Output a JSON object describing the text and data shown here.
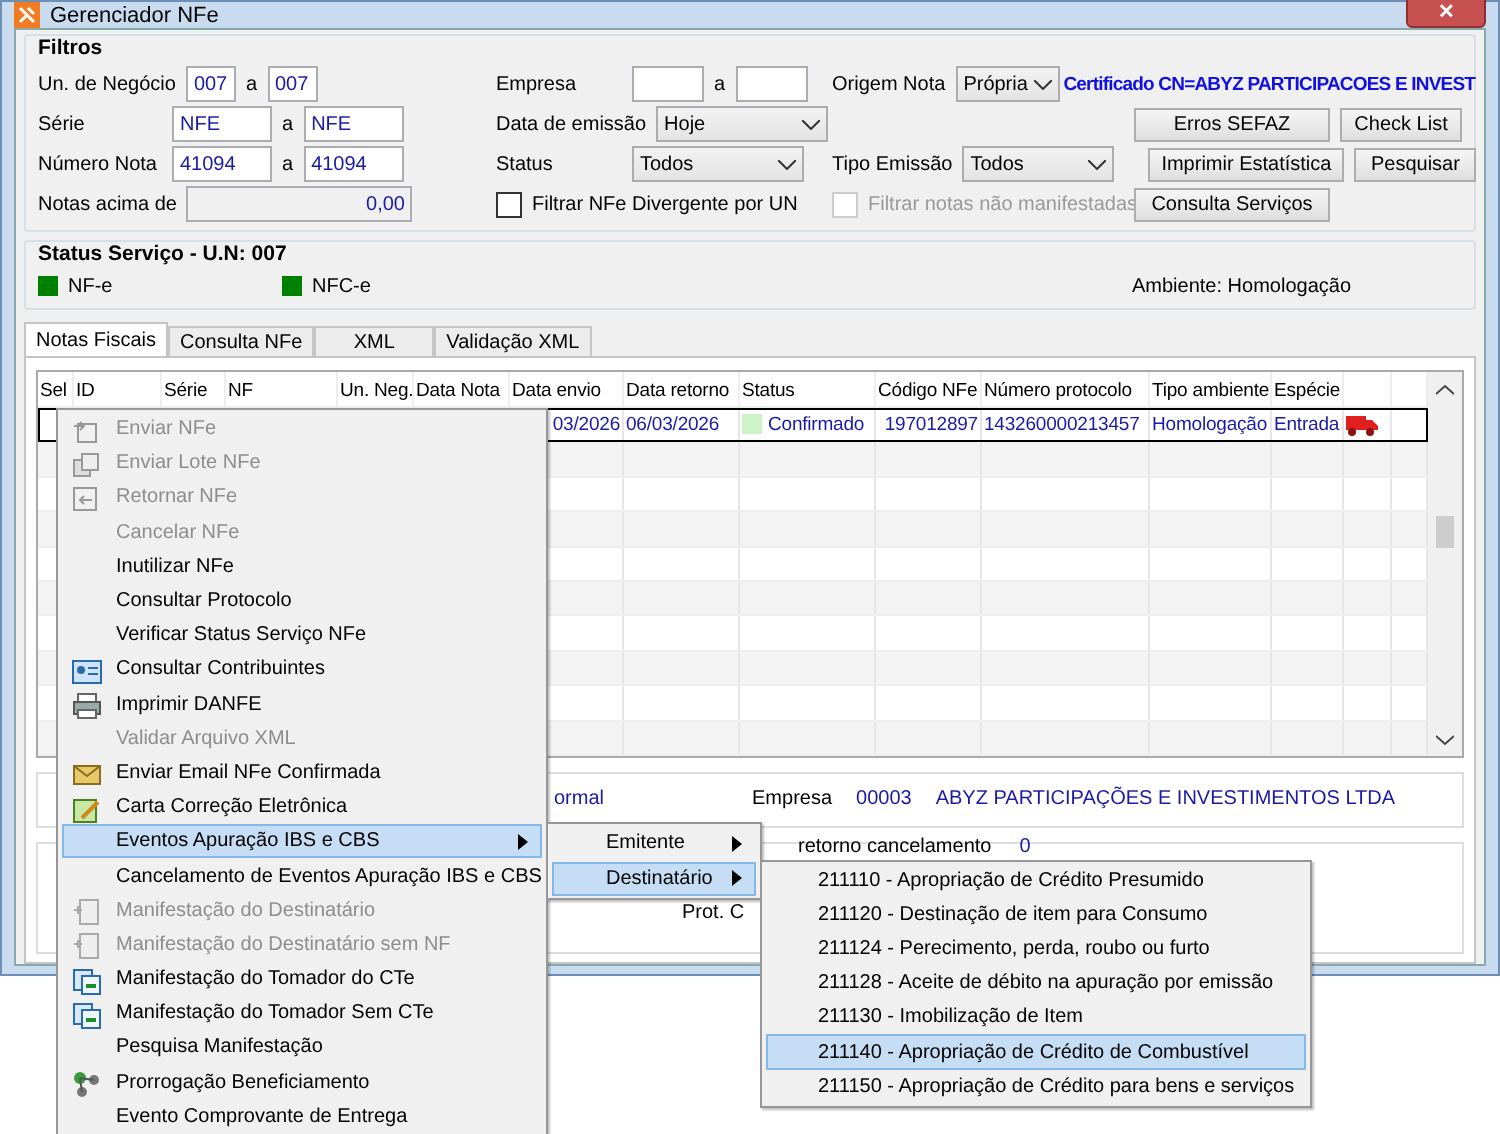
{
  "window": {
    "title": "Gerenciador NFe",
    "close": "✕"
  },
  "filters": {
    "title": "Filtros",
    "un_negocio": {
      "label": "Un. de Negócio",
      "from": "007",
      "sep": "a",
      "to": "007"
    },
    "serie": {
      "label": "Série",
      "from": "NFE",
      "sep": "a",
      "to": "NFE"
    },
    "numero": {
      "label": "Número Nota",
      "from": "41094",
      "sep": "a",
      "to": "41094"
    },
    "notas_acima": {
      "label": "Notas acima de",
      "value": "0,00",
      "disabled": true
    },
    "empresa": {
      "label": "Empresa",
      "sep": "a"
    },
    "data_emissao": {
      "label": "Data de emissão",
      "value": "Hoje"
    },
    "status": {
      "label": "Status",
      "value": "Todos"
    },
    "filtrar_divergente": {
      "label": "Filtrar NFe Divergente por UN",
      "checked": false,
      "disabled": false
    },
    "origem": {
      "label": "Origem Nota",
      "value": "Própria"
    },
    "certificado": "Certificado CN=ABYZ PARTICIPACOES E INVEST",
    "tipo_emissao": {
      "label": "Tipo Emissão",
      "value": "Todos"
    },
    "filtrar_manifestadas": {
      "label": "Filtrar notas não manifestadas",
      "checked": false,
      "disabled": true
    },
    "buttons": [
      [
        "Erros SEFAZ",
        "Check List"
      ],
      [
        "Imprimir Estatística",
        "Pesquisar"
      ],
      [
        "Consulta Serviços"
      ]
    ]
  },
  "status_servico": {
    "title": "Status Serviço - U.N: 007",
    "indicators": [
      {
        "label": "NF-e",
        "color": "#008000"
      },
      {
        "label": "NFC-e",
        "color": "#008000"
      }
    ],
    "ambiente": "Ambiente: Homologação"
  },
  "tabs": [
    {
      "label": "Notas Fiscais",
      "selected": true
    },
    {
      "label": "Consulta NFe",
      "selected": false
    },
    {
      "label": "XML",
      "selected": false
    },
    {
      "label": "Validação XML",
      "selected": false
    }
  ],
  "grid": {
    "columns": [
      "Sel",
      "ID",
      "Série",
      "NF",
      "Un. Neg.",
      "Data Nota",
      "Data envio",
      "Data retorno",
      "Status",
      "Código NFe",
      "Número protocolo",
      "Tipo ambiente",
      "Espécie"
    ],
    "rows": [
      {
        "selected": true,
        "data_envio": "03/2026",
        "data_retorno": "06/03/2026",
        "status": "Confirmado",
        "codigo": "197012897",
        "protocolo": "143260000213457",
        "tipo": "Homologação",
        "especie": "Entrada"
      }
    ]
  },
  "info": {
    "text": "ormal",
    "empresa_label": "Empresa",
    "empresa_code": "00003",
    "empresa_name": "ABYZ PARTICIPAÇÕES E INVESTIMENTOS LTDA"
  },
  "details": {
    "retorno_label": "retorno cancelamento",
    "retorno_value": "0",
    "prot_label": "Prot. C"
  },
  "context_menu": [
    {
      "label": "Enviar NFe",
      "disabled": true,
      "kind": "send",
      "selected": false
    },
    {
      "label": "Enviar Lote NFe",
      "disabled": true,
      "kind": "batch",
      "selected": false
    },
    {
      "label": "Retornar NFe",
      "disabled": true,
      "kind": "return",
      "selected": false
    },
    {
      "label": "Cancelar NFe",
      "disabled": true,
      "kind": "plain",
      "selected": false
    },
    {
      "label": "Inutilizar NFe",
      "disabled": false,
      "kind": "plain",
      "selected": false
    },
    {
      "label": "Consultar Protocolo",
      "disabled": false,
      "kind": "plain",
      "selected": false
    },
    {
      "label": "Verificar Status Serviço NFe",
      "disabled": false,
      "kind": "plain",
      "selected": false
    },
    {
      "label": "Consultar Contribuintes",
      "disabled": false,
      "kind": "card",
      "selected": false
    },
    {
      "label": "Imprimir DANFE",
      "disabled": false,
      "kind": "printer",
      "selected": false
    },
    {
      "label": "Validar Arquivo XML",
      "disabled": true,
      "kind": "plain",
      "selected": false
    },
    {
      "label": "Enviar Email NFe Confirmada",
      "disabled": false,
      "kind": "mail",
      "selected": false
    },
    {
      "label": "Carta Correção Eletrônica",
      "disabled": false,
      "kind": "letter",
      "selected": false
    },
    {
      "label": "Eventos Apuração IBS e CBS",
      "disabled": false,
      "kind": "submenu",
      "selected": true
    },
    {
      "label": "Cancelamento de Eventos Apuração IBS e CBS",
      "disabled": false,
      "kind": "plain",
      "selected": false
    },
    {
      "label": "Manifestação do Destinatário",
      "disabled": true,
      "kind": "doc",
      "selected": false
    },
    {
      "label": "Manifestação do Destinatário sem NF",
      "disabled": true,
      "kind": "doc",
      "selected": false
    },
    {
      "label": "Manifestação do Tomador do CTe",
      "disabled": false,
      "kind": "cte",
      "selected": false
    },
    {
      "label": "Manifestação do Tomador Sem CTe",
      "disabled": false,
      "kind": "cte",
      "selected": false
    },
    {
      "label": "Pesquisa Manifestação",
      "disabled": false,
      "kind": "plain",
      "selected": false
    },
    {
      "label": "Prorrogação Beneficiamento",
      "disabled": false,
      "kind": "nodes",
      "selected": false
    },
    {
      "label": "Evento Comprovante de Entrega",
      "disabled": false,
      "kind": "plain",
      "selected": false
    }
  ],
  "submenu": [
    {
      "label": "Emitente",
      "selected": false
    },
    {
      "label": "Destinatário",
      "selected": true
    }
  ],
  "submenu_items": [
    {
      "label": "211110 - Apropriação de Crédito Presumido",
      "selected": false
    },
    {
      "label": "211120 - Destinação de item para Consumo",
      "selected": false
    },
    {
      "label": "211124 - Perecimento, perda, roubo ou furto",
      "selected": false
    },
    {
      "label": "211128 - Aceite de débito na apuração por emissão",
      "selected": false
    },
    {
      "label": "211130 - Imobilização de Item",
      "selected": false
    },
    {
      "label": "211140 - Apropriação de Crédito de Combustível",
      "selected": true
    },
    {
      "label": "211150 - Apropriação de Crédito para bens e serviços",
      "selected": false
    }
  ]
}
